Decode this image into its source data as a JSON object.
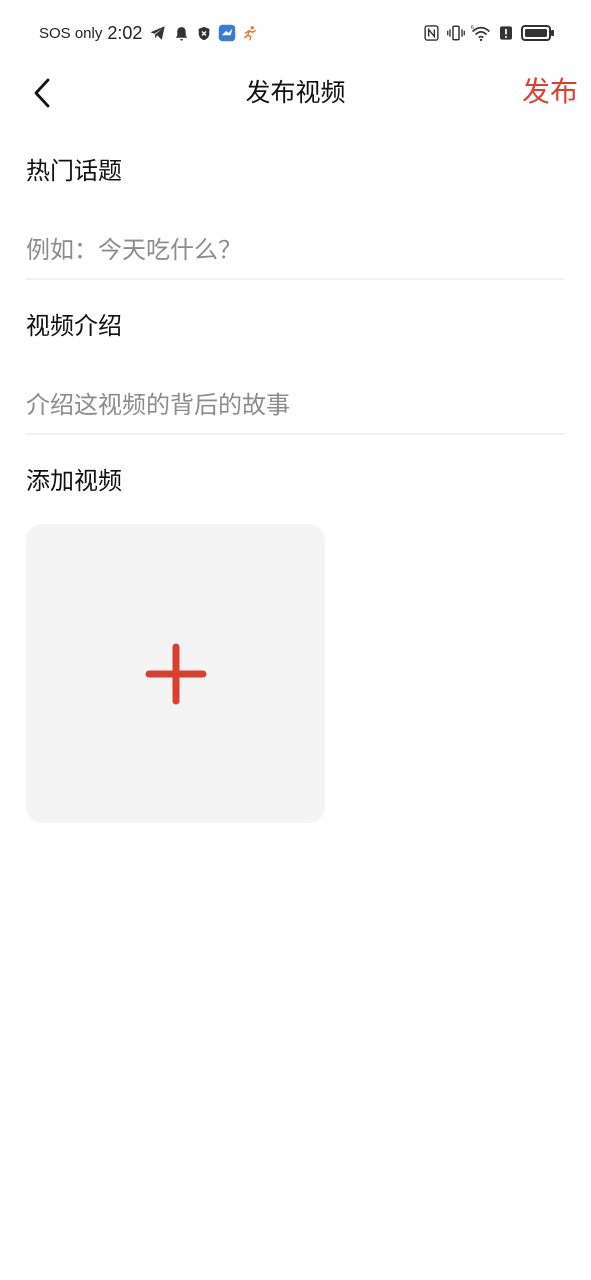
{
  "status_bar": {
    "carrier": "SOS only",
    "time": "2:02",
    "left_icons": [
      "telegram-icon",
      "bell-icon",
      "shield-icon",
      "app-bird-icon",
      "running-app-icon"
    ],
    "right_icons": [
      "nfc-icon",
      "vibrate-icon",
      "wifi-6-icon",
      "alert-icon",
      "battery-icon"
    ]
  },
  "nav": {
    "back_icon": "chevron-left-icon",
    "title": "发布视频",
    "publish_label": "发布"
  },
  "form": {
    "topic_label": "热门话题",
    "topic_placeholder": "例如：今天吃什么？",
    "topic_value": "",
    "intro_label": "视频介绍",
    "intro_placeholder": "介绍这视频的背后的故事",
    "intro_value": "",
    "add_video_label": "添加视频",
    "add_icon": "plus-icon"
  },
  "colors": {
    "accent": "#d9402f",
    "tile_background": "#f4f4f4",
    "divider": "#f1f1f1",
    "placeholder": "#8c8c8c",
    "text": "#111111"
  }
}
